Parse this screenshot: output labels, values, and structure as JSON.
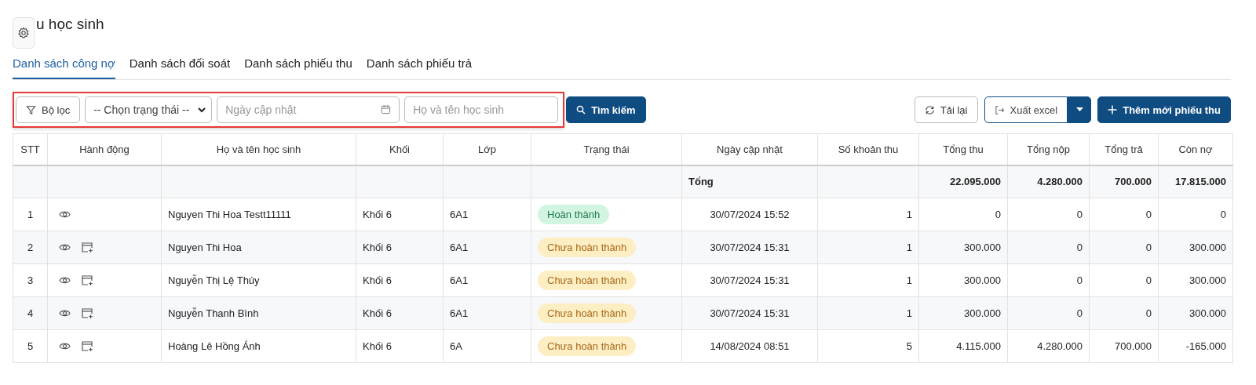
{
  "page": {
    "title": "u học sinh"
  },
  "tabs": [
    {
      "label": "Danh sách công nợ",
      "selected": true
    },
    {
      "label": "Danh sách đối soát",
      "selected": false
    },
    {
      "label": "Danh sách phiếu thu",
      "selected": false
    },
    {
      "label": "Danh sách phiếu trả",
      "selected": false
    }
  ],
  "filters": {
    "filter_button": "Bộ lọc",
    "status_select": "-- Chọn trạng thái --",
    "date_placeholder": "Ngày cập nhật",
    "name_placeholder": "Họ và tên học sinh",
    "search_button": "Tìm kiếm"
  },
  "actions": {
    "reload": "Tải lại",
    "export": "Xuất excel",
    "add": "Thêm mới phiếu thu"
  },
  "table": {
    "columns": [
      "STT",
      "Hành động",
      "Họ và tên học sinh",
      "Khối",
      "Lớp",
      "Trạng thái",
      "Ngày cập nhật",
      "Số khoản thu",
      "Tổng thu",
      "Tổng nộp",
      "Tổng trả",
      "Còn nợ"
    ],
    "total": {
      "label": "Tổng",
      "tong_thu": "22.095.000",
      "tong_nop": "4.280.000",
      "tong_tra": "700.000",
      "con_no": "17.815.000"
    },
    "rows": [
      {
        "stt": "1",
        "receipt_action": false,
        "name": "Nguyen Thi Hoa Testt11111",
        "khoi": "Khối 6",
        "lop": "6A1",
        "status": "Hoàn thành",
        "kind": "done",
        "date": "30/07/2024 15:52",
        "so_khoan": "1",
        "tong_thu": "0",
        "tong_nop": "0",
        "tong_tra": "0",
        "con_no": "0"
      },
      {
        "stt": "2",
        "receipt_action": true,
        "name": "Nguyen Thi Hoa",
        "khoi": "Khối 6",
        "lop": "6A1",
        "status": "Chưa hoàn thành",
        "kind": "pending",
        "date": "30/07/2024 15:31",
        "so_khoan": "1",
        "tong_thu": "300.000",
        "tong_nop": "0",
        "tong_tra": "0",
        "con_no": "300.000"
      },
      {
        "stt": "3",
        "receipt_action": true,
        "name": "Nguyễn Thị Lệ Thúy",
        "khoi": "Khối 6",
        "lop": "6A1",
        "status": "Chưa hoàn thành",
        "kind": "pending",
        "date": "30/07/2024 15:31",
        "so_khoan": "1",
        "tong_thu": "300.000",
        "tong_nop": "0",
        "tong_tra": "0",
        "con_no": "300.000"
      },
      {
        "stt": "4",
        "receipt_action": true,
        "name": "Nguyễn Thanh Bình",
        "khoi": "Khối 6",
        "lop": "6A1",
        "status": "Chưa hoàn thành",
        "kind": "pending",
        "date": "30/07/2024 15:31",
        "so_khoan": "1",
        "tong_thu": "300.000",
        "tong_nop": "0",
        "tong_tra": "0",
        "con_no": "300.000"
      },
      {
        "stt": "5",
        "receipt_action": true,
        "name": "Hoàng Lê Hồng Ánh",
        "khoi": "Khối 6",
        "lop": "6A",
        "status": "Chưa hoàn thành",
        "kind": "pending",
        "date": "14/08/2024 08:51",
        "so_khoan": "5",
        "tong_thu": "4.115.000",
        "tong_nop": "4.280.000",
        "tong_tra": "700.000",
        "con_no": "-165.000"
      }
    ]
  }
}
